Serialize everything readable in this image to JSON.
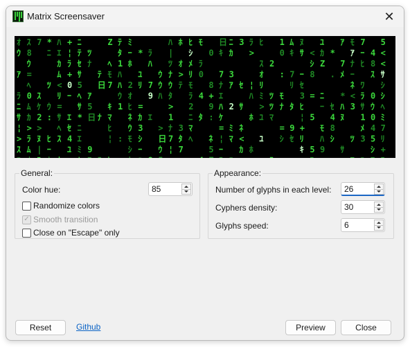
{
  "window": {
    "title": "Matrix Screensaver"
  },
  "colors": {
    "glyph": "#3bd93c",
    "glyph_dim": "#1f8a25",
    "glyph_bright": "#c8ffc8",
    "background": "#000000",
    "accent": "#1a66c4"
  },
  "preview": {
    "glyphs": "ﾊﾐﾋｰｳｼﾅﾓﾆｻﾜﾂｵﾘｱﾎﾃﾏｹﾒｴｶｷﾑﾕﾗｾﾈｽﾀﾇﾍ日012345789Z:.=*+<>¦|"
  },
  "general": {
    "label": "General:",
    "color_hue_label": "Color hue:",
    "color_hue_value": "85",
    "randomize_colors": {
      "label": "Randomize colors",
      "checked": false
    },
    "smooth_transition": {
      "label": "Smooth transition",
      "checked": true,
      "disabled": true
    },
    "close_on_escape": {
      "label": "Close on \"Escape\" only",
      "checked": false
    }
  },
  "appearance": {
    "label": "Appearance:",
    "glyphs_per_level_label": "Number of glyphs in each level:",
    "glyphs_per_level_value": "26",
    "cyphers_density_label": "Cyphers density:",
    "cyphers_density_value": "30",
    "glyphs_speed_label": "Glyphs speed:",
    "glyphs_speed_value": "6"
  },
  "footer": {
    "reset_label": "Reset",
    "github_label": "Github",
    "preview_label": "Preview",
    "close_label": "Close"
  }
}
